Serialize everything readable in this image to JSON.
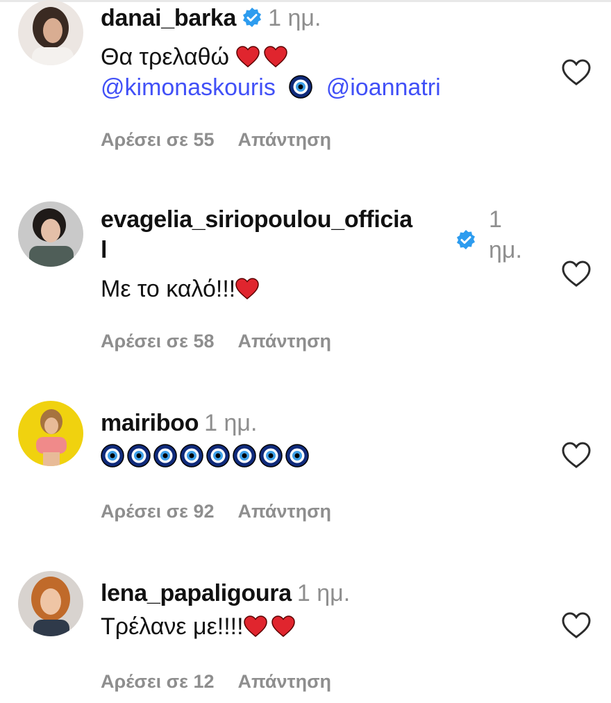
{
  "comments": [
    {
      "username": "danai_barka",
      "verified": true,
      "time": "1 ημ.",
      "text": "Θα τρελαθώ",
      "mention1": "@kimonaskouris",
      "mention2": "@ioannatri",
      "likes": "Αρέσει σε 55",
      "reply": "Απάντηση"
    },
    {
      "username_part1": "evagelia_siriopoulou_officia",
      "username_part2": "l",
      "verified": true,
      "time_part1": "1",
      "time_part2": "ημ.",
      "text": "Με το καλό!!!",
      "likes": "Αρέσει σε 58",
      "reply": "Απάντηση"
    },
    {
      "username": "mairiboo",
      "time": "1 ημ.",
      "likes": "Αρέσει σε 92",
      "reply": "Απάντηση"
    },
    {
      "username": "lena_papaligoura",
      "time": "1 ημ.",
      "text": "Τρέλανε με!!!!",
      "likes": "Αρέσει σε 12",
      "reply": "Απάντηση"
    }
  ],
  "colors": {
    "mention": "#4150f7",
    "heart_emoji": "#e0252e",
    "verified": "#2d9cef",
    "muted": "#8e8e8e"
  },
  "icons": [
    "heart-outline-icon",
    "verified-badge-icon",
    "red-heart-emoji",
    "nazar-eye-emoji"
  ]
}
